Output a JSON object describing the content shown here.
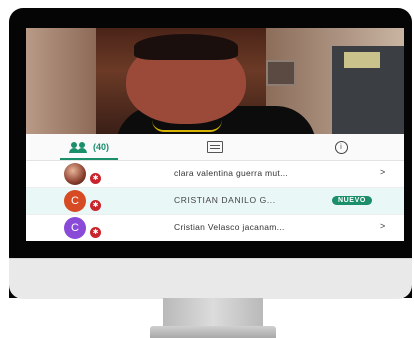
{
  "colors": {
    "accent": "#1b8f6a",
    "mic_red": "#c9242b",
    "avatar_orange": "#d64b24",
    "avatar_purple": "#8a4ad8"
  },
  "tabs": [
    {
      "icon": "people-icon",
      "label": "(40)",
      "active": true
    },
    {
      "icon": "chat-icon",
      "active": false
    },
    {
      "icon": "info-icon",
      "glyph": "i",
      "active": false
    }
  ],
  "participants": [
    {
      "avatar_type": "photo",
      "avatar_letter": "",
      "name": "clara valentina guerra mut...",
      "chevron": ">",
      "badge": ""
    },
    {
      "avatar_type": "letter",
      "avatar_letter": "C",
      "avatar_color": "#d64b24",
      "name": "CRISTIAN DANILO G...",
      "badge": "NUEVO",
      "chevron": ""
    },
    {
      "avatar_type": "letter",
      "avatar_letter": "C",
      "avatar_color": "#8a4ad8",
      "name": "Cristian Velasco jacanam...",
      "chevron": ">",
      "badge": ""
    }
  ],
  "mic_glyph": "✱"
}
